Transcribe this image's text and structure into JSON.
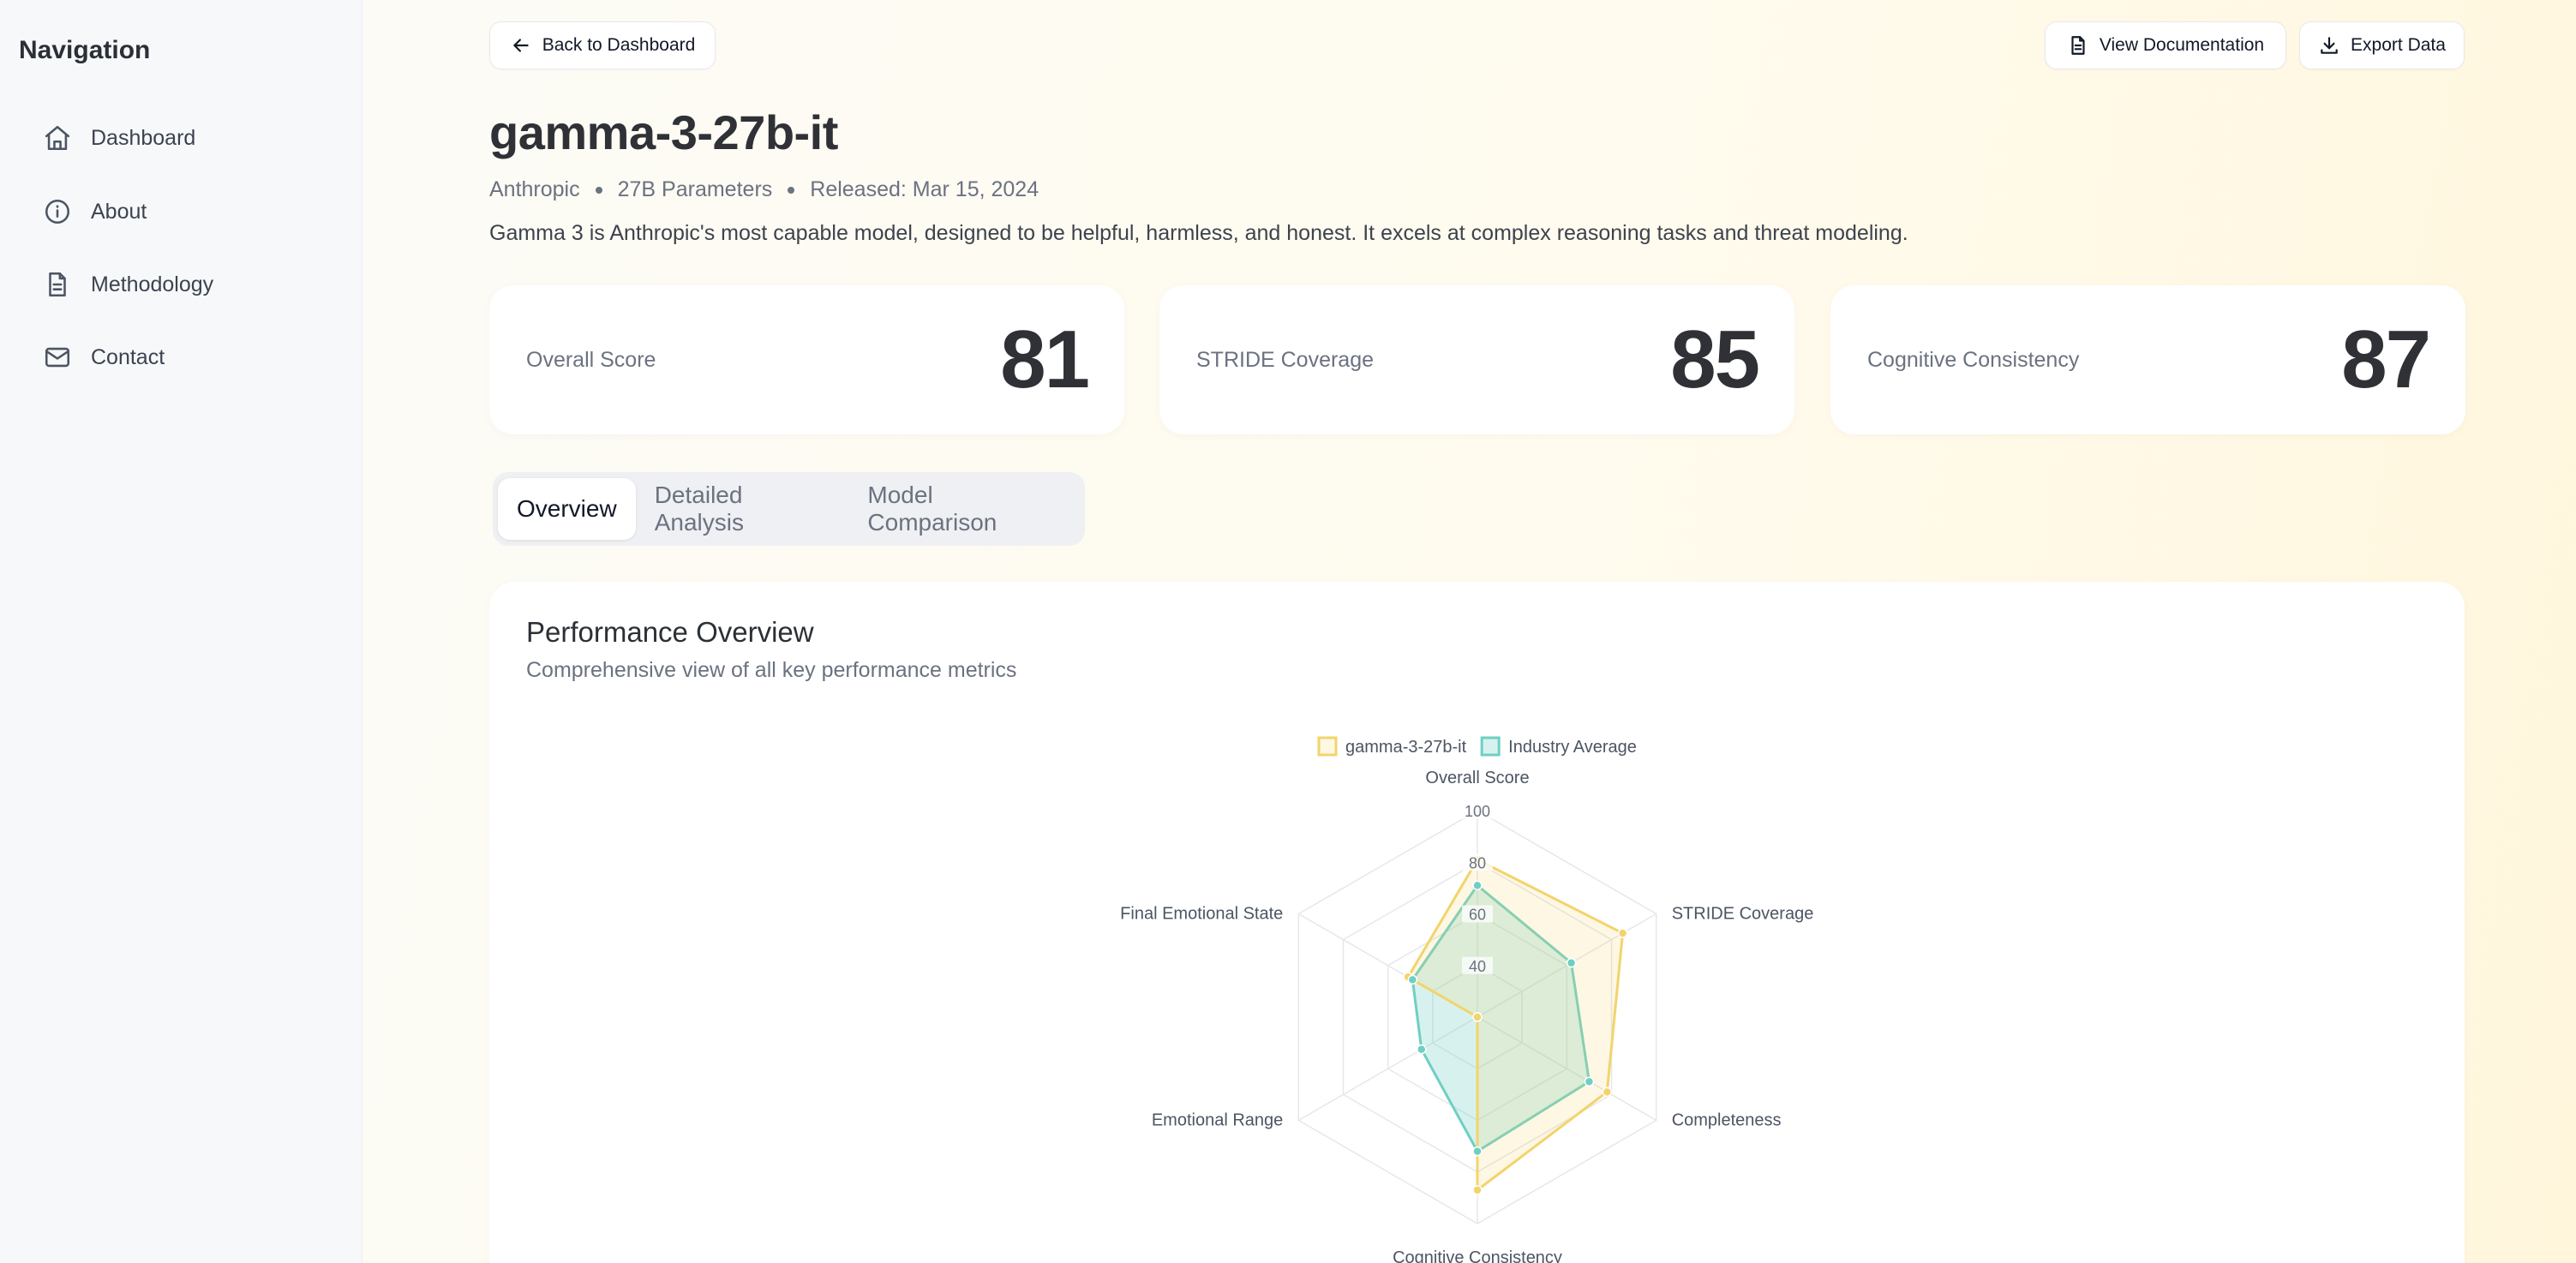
{
  "sidebar": {
    "title": "Navigation",
    "items": [
      {
        "label": "Dashboard",
        "icon": "home-icon"
      },
      {
        "label": "About",
        "icon": "info-icon"
      },
      {
        "label": "Methodology",
        "icon": "document-icon"
      },
      {
        "label": "Contact",
        "icon": "mail-icon"
      }
    ]
  },
  "header": {
    "back_label": "Back to Dashboard",
    "docs_label": "View Documentation",
    "export_label": "Export Data"
  },
  "model": {
    "name": "gamma-3-27b-it",
    "provider": "Anthropic",
    "parameters": "27B Parameters",
    "released": "Released: Mar 15, 2024",
    "description": "Gamma 3 is Anthropic's most capable model, designed to be helpful, harmless, and honest. It excels at complex reasoning tasks and threat modeling."
  },
  "scores": [
    {
      "label": "Overall Score",
      "value": "81"
    },
    {
      "label": "STRIDE Coverage",
      "value": "85"
    },
    {
      "label": "Cognitive Consistency",
      "value": "87"
    }
  ],
  "tabs": [
    {
      "label": "Overview",
      "active": true
    },
    {
      "label": "Detailed Analysis",
      "active": false
    },
    {
      "label": "Model Comparison",
      "active": false
    }
  ],
  "panel": {
    "title": "Performance Overview",
    "subtitle": "Comprehensive view of all key performance metrics"
  },
  "colors": {
    "model_series": "#f2d46b",
    "industry_series": "#6fcfc3"
  },
  "chart_data": {
    "type": "radar",
    "categories": [
      "Overall Score",
      "STRIDE Coverage",
      "Completeness",
      "Cognitive Consistency",
      "Emotional Range",
      "Final Emotional State"
    ],
    "series": [
      {
        "name": "gamma-3-27b-it",
        "values": [
          81,
          85,
          78,
          87,
          20,
          51
        ]
      },
      {
        "name": "Industry Average",
        "values": [
          71,
          62,
          70,
          72,
          45,
          49
        ]
      }
    ],
    "r_range": [
      20,
      100
    ],
    "tick_labels": [
      "40",
      "60",
      "80",
      "100"
    ],
    "legend": "top"
  }
}
